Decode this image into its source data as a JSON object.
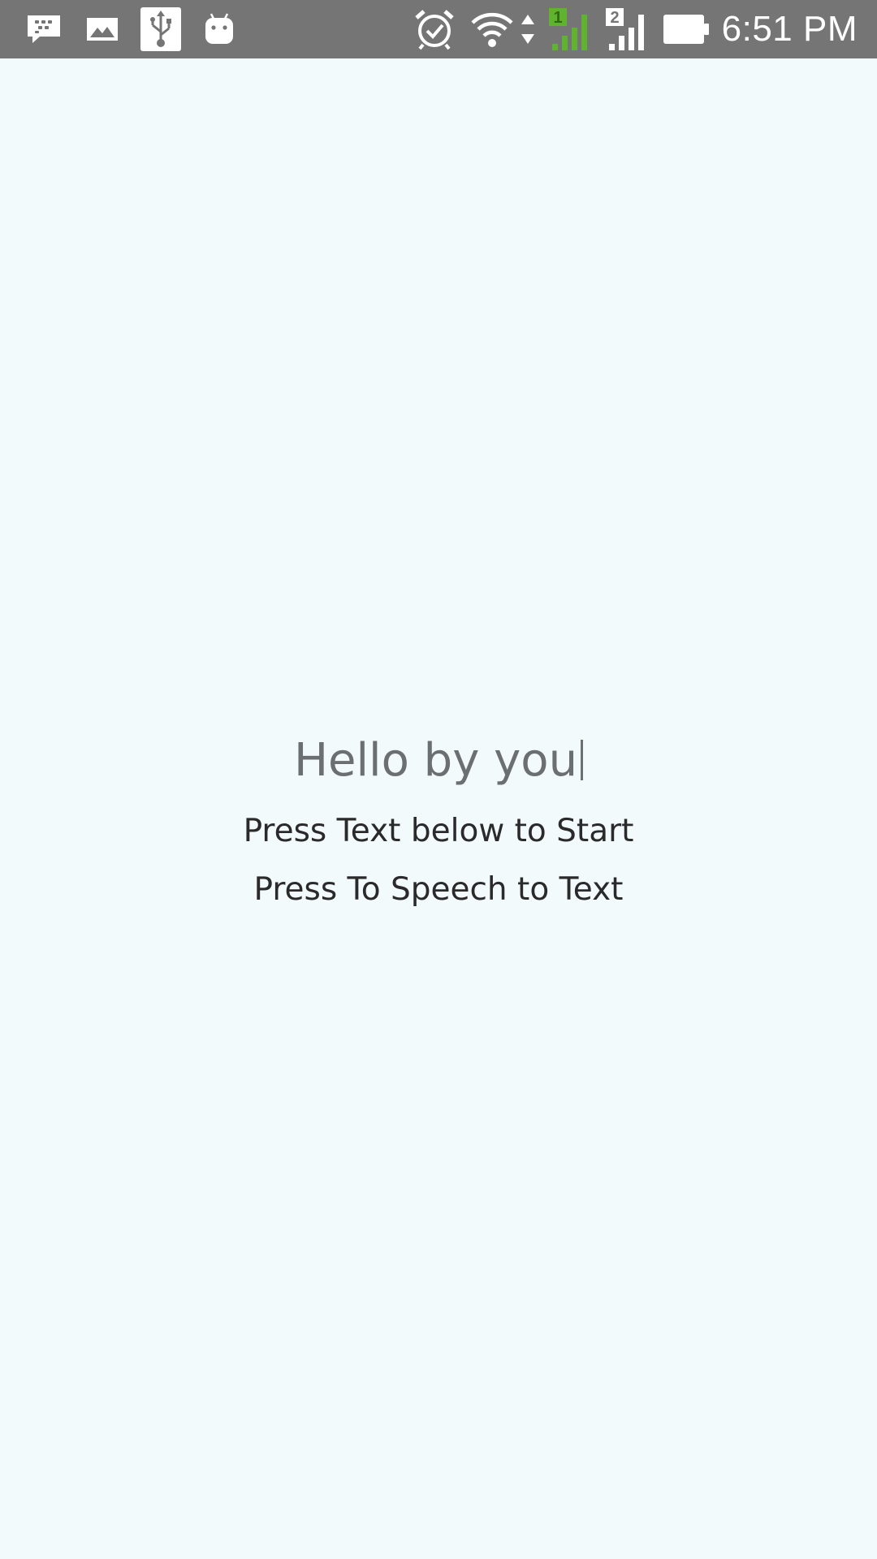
{
  "status_bar": {
    "time": "6:51 PM",
    "notification_icons": [
      "bbm-chat-icon",
      "image-icon",
      "usb-icon",
      "android-icon"
    ],
    "system_icons": [
      "alarm-icon",
      "wifi-icon",
      "data-arrows-icon",
      "signal-sim1-icon",
      "signal-sim2-icon",
      "battery-icon"
    ],
    "sim1_label": "1",
    "sim2_label": "2",
    "sim1_color": "#5fb32e",
    "background_color": "#757575"
  },
  "main": {
    "input_text": "Hello by you",
    "start_text": "Press Text below to Start",
    "speech_text": "Press To Speech to Text",
    "background_color": "#f3fafc"
  }
}
